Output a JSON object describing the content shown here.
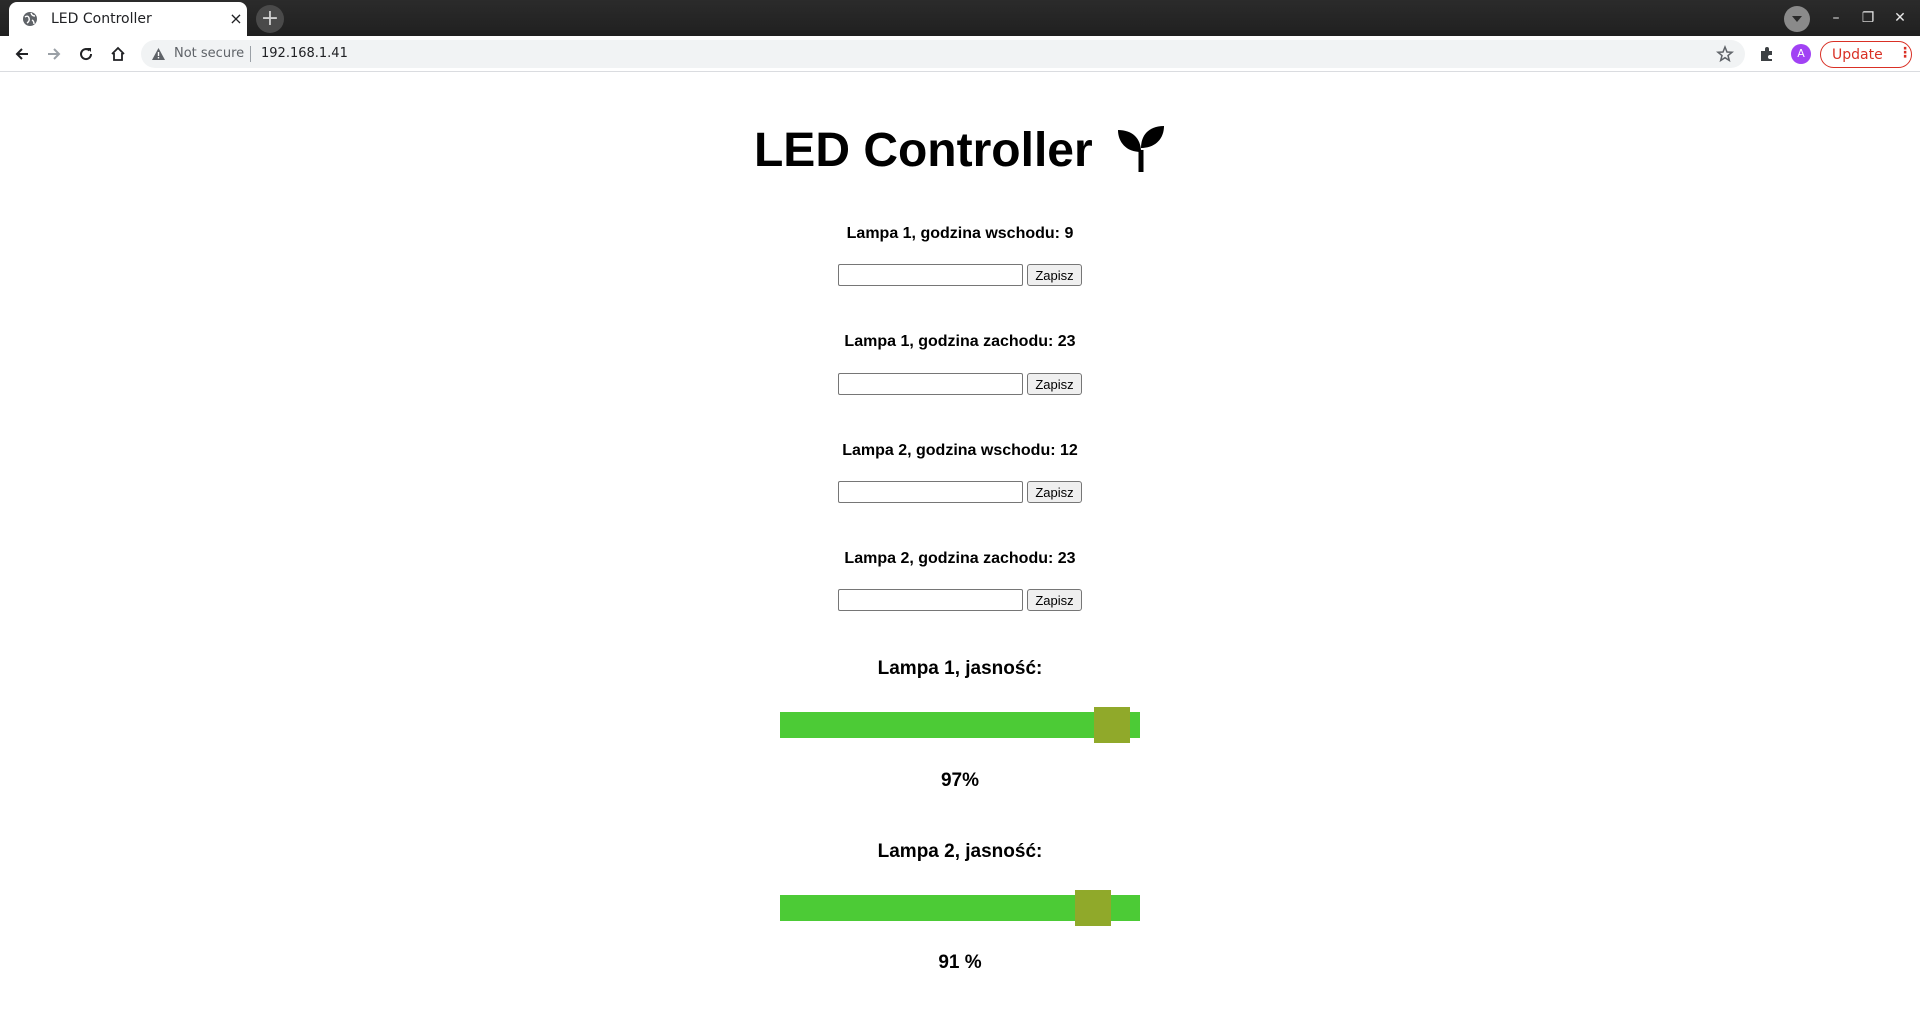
{
  "browser": {
    "tab_title": "LED Controller",
    "tab_close": "×",
    "new_tab": "+",
    "security_label": "Not secure",
    "url": "192.168.1.41",
    "update_label": "Update",
    "update_menu": "⋮",
    "avatar_letter": "A",
    "window_controls": {
      "minimize": "–",
      "restore": "❐",
      "close": "✕"
    }
  },
  "page": {
    "title": "LED Controller",
    "title_icon": "sprout-icon",
    "schedule": [
      {
        "label": "Lampa 1, godzina wschodu: 9",
        "input_value": "",
        "button": "Zapisz"
      },
      {
        "label": "Lampa 1, godzina zachodu: 23",
        "input_value": "",
        "button": "Zapisz"
      },
      {
        "label": "Lampa 2, godzina wschodu: 12",
        "input_value": "",
        "button": "Zapisz"
      },
      {
        "label": "Lampa 2, godzina zachodu: 23",
        "input_value": "",
        "button": "Zapisz"
      }
    ],
    "brightness": [
      {
        "label": "Lampa 1, jasność:",
        "value": 97,
        "value_text": "97%"
      },
      {
        "label": "Lampa 2, jasność:",
        "value": 91,
        "value_text": "91 %"
      }
    ]
  },
  "colors": {
    "slider_track": "#4ccb36",
    "slider_thumb": "#90a92a",
    "update_accent": "#d93025"
  }
}
